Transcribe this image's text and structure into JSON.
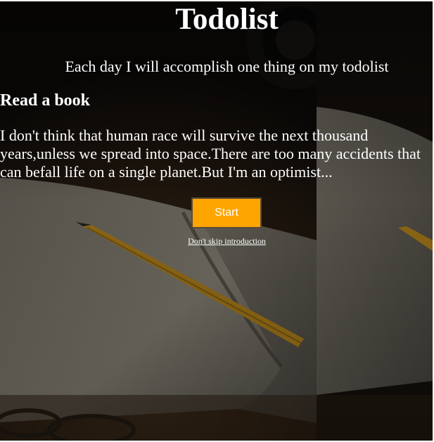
{
  "header": {
    "title": "Todolist",
    "subtitle": "Each day I will accomplish one thing on my todolist"
  },
  "task": {
    "title": "Read a book",
    "text": "I don't think that human race will survive the next thousand years,unless we spread into space.There are too many accidents that can befall life on a single planet.But I'm an optimist..."
  },
  "actions": {
    "start_label": "Start",
    "skip_label": "Don't skip introduction"
  },
  "colors": {
    "start_button": "#ffa500",
    "text": "#ffffff",
    "background": "#0d0b09"
  }
}
